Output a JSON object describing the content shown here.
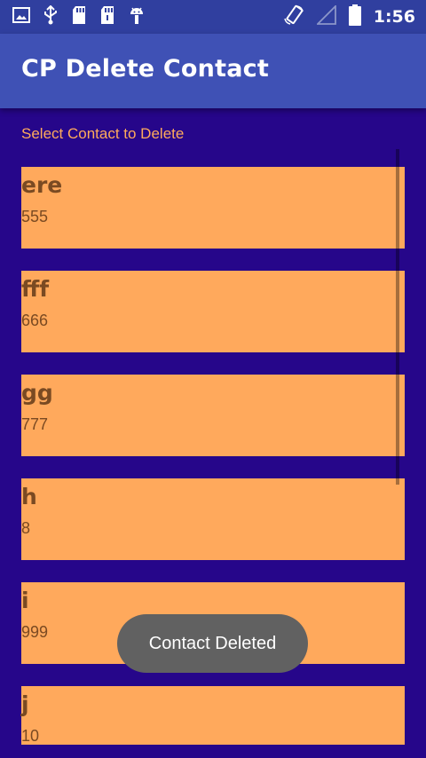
{
  "status_bar": {
    "left_icons": [
      "image-icon",
      "usb-icon",
      "sd-card-icon",
      "sd-card-icon",
      "android-icon"
    ],
    "right_icons": [
      "rotate-icon",
      "signal-icon",
      "battery-icon"
    ],
    "time": "1:56"
  },
  "app_bar": {
    "title": "CP Delete Contact"
  },
  "prompt": "Select Contact to Delete",
  "contacts": [
    {
      "name": "ere",
      "number": "555"
    },
    {
      "name": "fff",
      "number": "666"
    },
    {
      "name": "gg",
      "number": "777"
    },
    {
      "name": "h",
      "number": "8"
    },
    {
      "name": "i",
      "number": "999"
    },
    {
      "name": "j",
      "number": "10"
    }
  ],
  "toast": "Contact Deleted",
  "colors": {
    "status_bar": "#303f9f",
    "app_bar": "#3f51b5",
    "background": "#26068a",
    "accent": "#ffa95c",
    "item_text": "#7a4a22",
    "toast": "#616161"
  }
}
